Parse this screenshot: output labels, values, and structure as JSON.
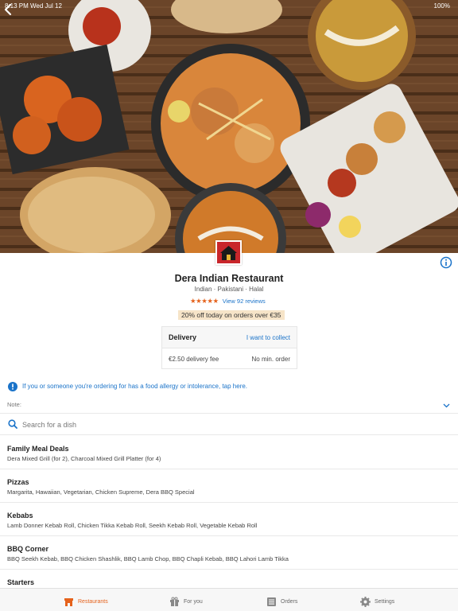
{
  "status_bar": {
    "time": "8:13 PM  Wed Jul 12",
    "battery": "100%"
  },
  "restaurant": {
    "name": "Dera Indian Restaurant",
    "cuisines": "Indian · Pakistani · Halal",
    "rating": 4.5,
    "reviews_label": "View 92 reviews",
    "promo": "20% off today on orders over €35"
  },
  "delivery": {
    "mode_label": "Delivery",
    "collect_label": "I want to collect",
    "fee": "€2.50 delivery fee",
    "min_order": "No min. order"
  },
  "allergy_text": "If you or someone you're ordering for has a food allergy or intolerance, tap here.",
  "note_label": "Note:",
  "search": {
    "placeholder": "Search for a dish"
  },
  "categories": [
    {
      "title": "Family Meal Deals",
      "items": "Dera Mixed Grill (for 2), Charcoal Mixed Grill Platter (for 4)"
    },
    {
      "title": "Pizzas",
      "items": "Margarita, Hawaiian, Vegetarian, Chicken Supreme, Dera BBQ Special"
    },
    {
      "title": "Kebabs",
      "items": "Lamb Donner Kebab Roll, Chicken Tikka Kebab Roll, Seekh Kebab Roll, Vegetable Kebab Roll"
    },
    {
      "title": "BBQ Corner",
      "items": "BBQ Seekh Kebab, BBQ Chicken Shashlik, BBQ Lamb Chop, BBQ Chapli Kebab, BBQ Lahori Lamb Tikka"
    },
    {
      "title": "Starters",
      "items": ""
    }
  ],
  "tabs": [
    {
      "label": "Restaurants",
      "icon": "restaurant-icon",
      "active": true
    },
    {
      "label": "For you",
      "icon": "gift-icon",
      "active": false
    },
    {
      "label": "Orders",
      "icon": "orders-icon",
      "active": false
    },
    {
      "label": "Settings",
      "icon": "gear-icon",
      "active": false
    }
  ],
  "colors": {
    "accent": "#e5621c",
    "link": "#1a73c9",
    "promo_bg": "#f6e4c8"
  }
}
